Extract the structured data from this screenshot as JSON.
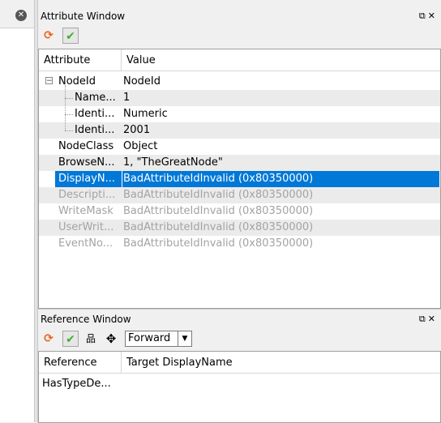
{
  "left_panel": {
    "close_icon": "close-icon"
  },
  "attribute_window": {
    "title": "Attribute Window",
    "title_controls": {
      "float_icon": "float-icon",
      "close_icon": "close-icon"
    },
    "toolbar": {
      "refresh_icon": "refresh-icon",
      "apply_icon": "check-icon"
    },
    "columns": [
      "Attribute",
      "Value"
    ],
    "rows": [
      {
        "attribute": "NodeId",
        "value": "NodeId",
        "level": 0,
        "expander": "minus",
        "state": "normal",
        "alt": false
      },
      {
        "attribute": "Name...",
        "value": "1",
        "level": 1,
        "state": "normal",
        "alt": true
      },
      {
        "attribute": "Identi...",
        "value": "Numeric",
        "level": 1,
        "state": "normal",
        "alt": false
      },
      {
        "attribute": "Identi...",
        "value": "2001",
        "level": 1,
        "state": "normal",
        "alt": true
      },
      {
        "attribute": "NodeClass",
        "value": "Object",
        "level": 0,
        "state": "normal",
        "alt": false
      },
      {
        "attribute": "BrowseN...",
        "value": "1, \"TheGreatNode\"",
        "level": 0,
        "state": "normal",
        "alt": true
      },
      {
        "attribute": "DisplayN...",
        "value": "BadAttributeIdInvalid (0x80350000)",
        "level": 0,
        "state": "selected",
        "alt": false
      },
      {
        "attribute": "Descripti...",
        "value": "BadAttributeIdInvalid (0x80350000)",
        "level": 0,
        "state": "disabled",
        "alt": true
      },
      {
        "attribute": "WriteMask",
        "value": "BadAttributeIdInvalid (0x80350000)",
        "level": 0,
        "state": "disabled",
        "alt": false
      },
      {
        "attribute": "UserWrit...",
        "value": "BadAttributeIdInvalid (0x80350000)",
        "level": 0,
        "state": "disabled",
        "alt": true
      },
      {
        "attribute": "EventNo...",
        "value": "BadAttributeIdInvalid (0x80350000)",
        "level": 0,
        "state": "disabled",
        "alt": false
      }
    ]
  },
  "reference_window": {
    "title": "Reference Window",
    "title_controls": {
      "float_icon": "float-icon",
      "close_icon": "close-icon"
    },
    "toolbar": {
      "refresh_icon": "refresh-icon",
      "apply_icon": "check-icon",
      "hierarchy_icon": "hierarchy-icon",
      "move_icon": "move-icon",
      "direction_selected": "Forward"
    },
    "columns": [
      "Reference",
      "Target DisplayName"
    ],
    "rows": [
      {
        "reference": "HasTypeDe...",
        "target": ""
      }
    ]
  },
  "colors": {
    "selection": "#0078d7",
    "refresh": "#e8641e",
    "check": "#3cae2e",
    "disabled_text": "#a3a3a3"
  }
}
